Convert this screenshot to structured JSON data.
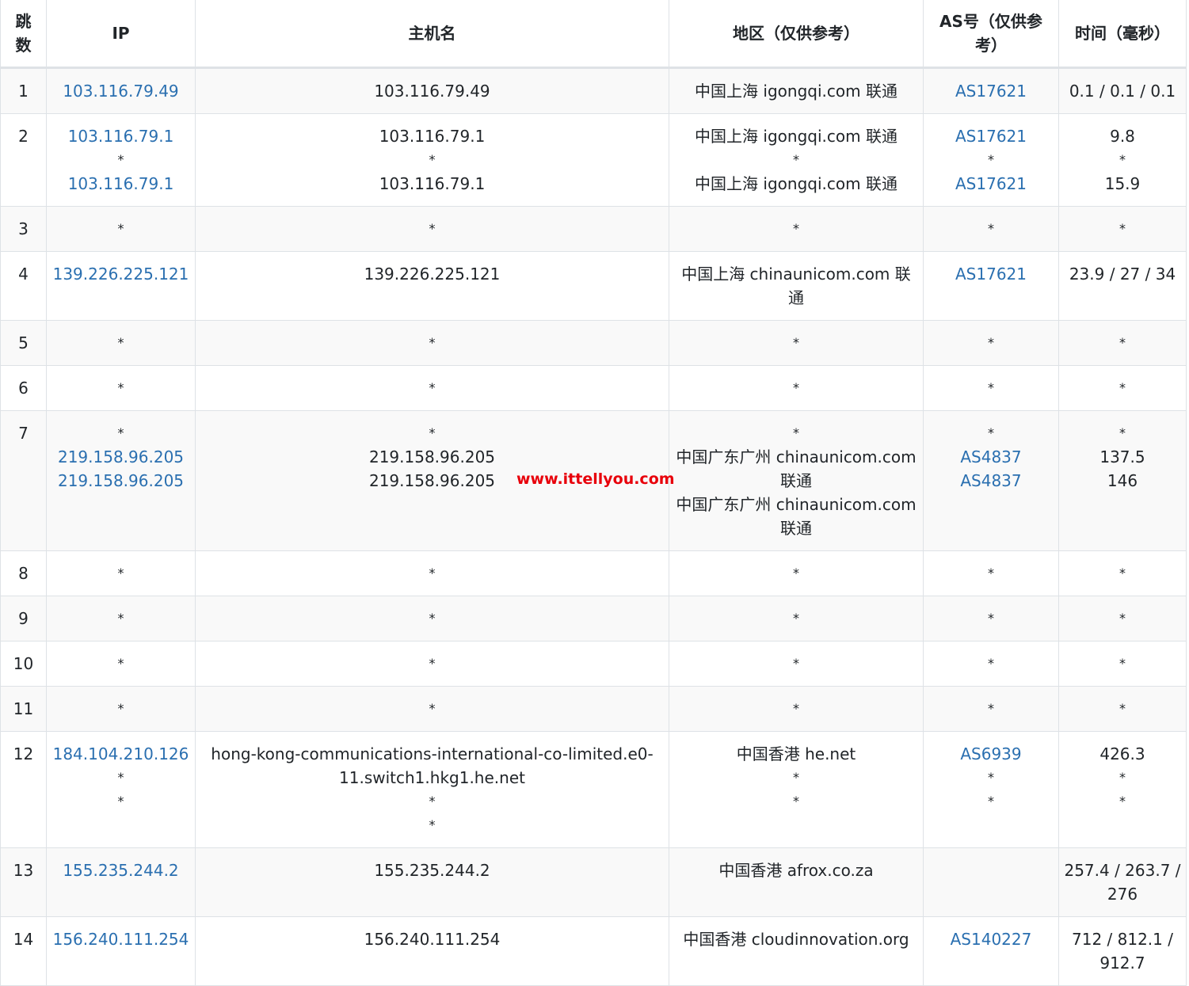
{
  "headers": {
    "hop": "跳数",
    "ip": "IP",
    "host": "主机名",
    "region": "地区（仅供参考）",
    "as": "AS号（仅供参考）",
    "time": "时间（毫秒）"
  },
  "rows": [
    {
      "hop": "1",
      "ip": [
        "103.116.79.49"
      ],
      "host": [
        "103.116.79.49"
      ],
      "region": [
        "中国上海 igongqi.com 联通"
      ],
      "as": [
        "AS17621"
      ],
      "time": [
        "0.1 / 0.1 / 0.1"
      ]
    },
    {
      "hop": "2",
      "ip": [
        "103.116.79.1",
        "*",
        "103.116.79.1"
      ],
      "host": [
        "103.116.79.1",
        "*",
        "103.116.79.1"
      ],
      "region": [
        "中国上海 igongqi.com 联通",
        "*",
        "中国上海 igongqi.com 联通"
      ],
      "as": [
        "AS17621",
        "*",
        "AS17621"
      ],
      "time": [
        "9.8",
        "*",
        "15.9"
      ]
    },
    {
      "hop": "3",
      "ip": [
        "*"
      ],
      "host": [
        "*"
      ],
      "region": [
        "*"
      ],
      "as": [
        "*"
      ],
      "time": [
        "*"
      ]
    },
    {
      "hop": "4",
      "ip": [
        "139.226.225.121"
      ],
      "host": [
        "139.226.225.121"
      ],
      "region": [
        "中国上海 chinaunicom.com 联通"
      ],
      "as": [
        "AS17621"
      ],
      "time": [
        "23.9 / 27 / 34"
      ]
    },
    {
      "hop": "5",
      "ip": [
        "*"
      ],
      "host": [
        "*"
      ],
      "region": [
        "*"
      ],
      "as": [
        "*"
      ],
      "time": [
        "*"
      ]
    },
    {
      "hop": "6",
      "ip": [
        "*"
      ],
      "host": [
        "*"
      ],
      "region": [
        "*"
      ],
      "as": [
        "*"
      ],
      "time": [
        "*"
      ]
    },
    {
      "hop": "7",
      "ip": [
        "*",
        "219.158.96.205",
        "219.158.96.205"
      ],
      "host": [
        "*",
        "219.158.96.205",
        "219.158.96.205"
      ],
      "region": [
        "*",
        "中国广东广州 chinaunicom.com 联通",
        "中国广东广州 chinaunicom.com 联通"
      ],
      "as": [
        "*",
        "AS4837",
        "AS4837"
      ],
      "time": [
        "*",
        "137.5",
        "146"
      ]
    },
    {
      "hop": "8",
      "ip": [
        "*"
      ],
      "host": [
        "*"
      ],
      "region": [
        "*"
      ],
      "as": [
        "*"
      ],
      "time": [
        "*"
      ]
    },
    {
      "hop": "9",
      "ip": [
        "*"
      ],
      "host": [
        "*"
      ],
      "region": [
        "*"
      ],
      "as": [
        "*"
      ],
      "time": [
        "*"
      ]
    },
    {
      "hop": "10",
      "ip": [
        "*"
      ],
      "host": [
        "*"
      ],
      "region": [
        "*"
      ],
      "as": [
        "*"
      ],
      "time": [
        "*"
      ]
    },
    {
      "hop": "11",
      "ip": [
        "*"
      ],
      "host": [
        "*"
      ],
      "region": [
        "*"
      ],
      "as": [
        "*"
      ],
      "time": [
        "*"
      ]
    },
    {
      "hop": "12",
      "ip": [
        "184.104.210.126",
        "*",
        "*"
      ],
      "host": [
        "hong-kong-communications-international-co-limited.e0-11.switch1.hkg1.he.net",
        "*",
        "*"
      ],
      "region": [
        "中国香港 he.net",
        "*",
        "*"
      ],
      "as": [
        "AS6939",
        "*",
        "*"
      ],
      "time": [
        "426.3",
        "*",
        "*"
      ]
    },
    {
      "hop": "13",
      "ip": [
        "155.235.244.2"
      ],
      "host": [
        "155.235.244.2"
      ],
      "region": [
        "中国香港 afrox.co.za"
      ],
      "as": [],
      "time": [
        "257.4 / 263.7 / 276"
      ]
    },
    {
      "hop": "14",
      "ip": [
        "156.240.111.254"
      ],
      "host": [
        "156.240.111.254"
      ],
      "region": [
        "中国香港 cloudinnovation.org"
      ],
      "as": [
        "AS140227"
      ],
      "time": [
        "712 / 812.1 / 912.7"
      ]
    }
  ],
  "watermark": "www.ittellyou.com",
  "colors": {
    "link": "#2a6fb0",
    "watermark": "#e8000b",
    "border": "#dee2e6",
    "stripe": "#f9f9f9"
  }
}
